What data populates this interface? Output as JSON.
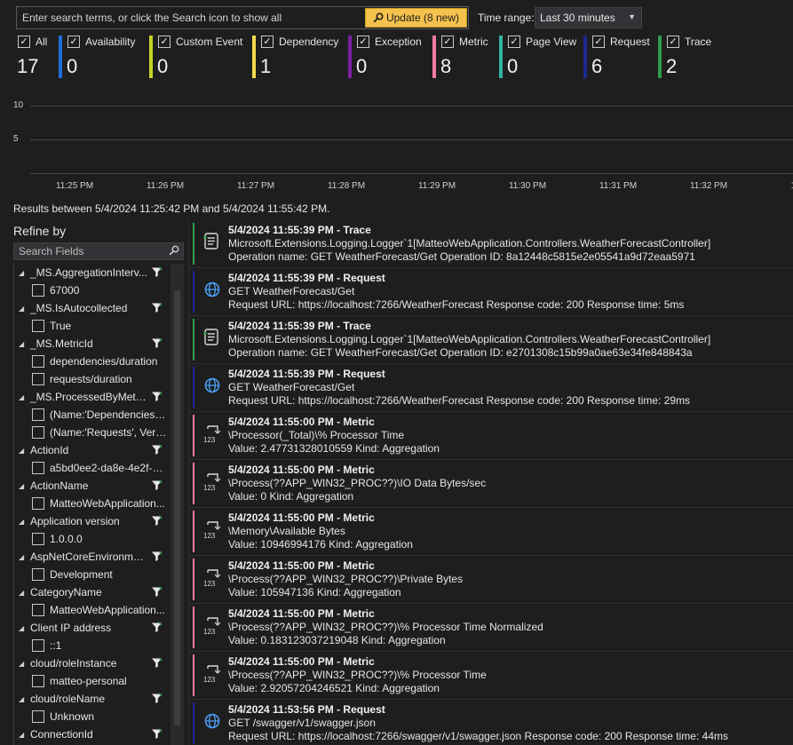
{
  "search": {
    "placeholder": "Enter search terms, or click the Search icon to show all",
    "update_label": "Update (8 new)"
  },
  "time_range": {
    "label": "Time range:",
    "selected": "Last 30 minutes"
  },
  "filters": [
    {
      "label": "All",
      "count": "17",
      "checked": true,
      "color": ""
    },
    {
      "label": "Availability",
      "count": "0",
      "checked": true,
      "color": "#1e6fd9"
    },
    {
      "label": "Custom Event",
      "count": "0",
      "checked": true,
      "color": "#c8d32a"
    },
    {
      "label": "Dependency",
      "count": "1",
      "checked": true,
      "color": "#f2d94e"
    },
    {
      "label": "Exception",
      "count": "0",
      "checked": true,
      "color": "#7a1fa2"
    },
    {
      "label": "Metric",
      "count": "8",
      "checked": true,
      "color": "#f27ca8"
    },
    {
      "label": "Page View",
      "count": "0",
      "checked": true,
      "color": "#2fb4a0"
    },
    {
      "label": "Request",
      "count": "6",
      "checked": true,
      "color": "#1b2a8f"
    },
    {
      "label": "Trace",
      "count": "2",
      "checked": true,
      "color": "#2e9e4f"
    }
  ],
  "chart_data": {
    "type": "bar",
    "y_ticks": [
      "10",
      "5"
    ],
    "ylim": [
      0,
      10
    ],
    "categories": [
      "11:25 PM",
      "11:26 PM",
      "11:27 PM",
      "11:28 PM",
      "11:29 PM",
      "11:30 PM",
      "11:31 PM",
      "11:32 PM",
      "11:3"
    ],
    "values": [],
    "grid": true
  },
  "results_range": "Results between 5/4/2024 11:25:42 PM and 5/4/2024 11:55:42 PM.",
  "refine": {
    "title": "Refine by",
    "search_placeholder": "Search Fields",
    "facets": [
      {
        "name": "_MS.AggregationInterv...",
        "values": [
          "67000"
        ]
      },
      {
        "name": "_MS.IsAutocollected",
        "values": [
          "True"
        ]
      },
      {
        "name": "_MS.MetricId",
        "values": [
          "dependencies/duration",
          "requests/duration"
        ]
      },
      {
        "name": "_MS.ProcessedByMetri...",
        "values": [
          "(Name:'Dependencies',...",
          "(Name:'Requests', Ver:'..."
        ]
      },
      {
        "name": "ActionId",
        "values": [
          "a5bd0ee2-da8e-4e2f-9..."
        ]
      },
      {
        "name": "ActionName",
        "values": [
          "MatteoWebApplication..."
        ]
      },
      {
        "name": "Application version",
        "values": [
          "1.0.0.0"
        ]
      },
      {
        "name": "AspNetCoreEnvironme...",
        "values": [
          "Development"
        ]
      },
      {
        "name": "CategoryName",
        "values": [
          "MatteoWebApplication..."
        ]
      },
      {
        "name": "Client IP address",
        "values": [
          "::1"
        ]
      },
      {
        "name": "cloud/roleInstance",
        "values": [
          "matteo-personal"
        ]
      },
      {
        "name": "cloud/roleName",
        "values": [
          "Unknown"
        ]
      },
      {
        "name": "ConnectionId",
        "values": []
      }
    ]
  },
  "results": [
    {
      "kind": "trace",
      "color": "#2e9e4f",
      "title": "5/4/2024 11:55:39 PM - Trace",
      "line2": "Microsoft.Extensions.Logging.Logger`1[MatteoWebApplication.Controllers.WeatherForecastController]",
      "line3": "Operation name: GET WeatherForecast/Get  Operation ID: 8a12448c5815e2e05541a9d72eaa5971"
    },
    {
      "kind": "request",
      "color": "#1b2a8f",
      "title": "5/4/2024 11:55:39 PM - Request",
      "line2": "GET WeatherForecast/Get",
      "line3": "Request URL: https://localhost:7266/WeatherForecast  Response code: 200  Response time: 5ms"
    },
    {
      "kind": "trace",
      "color": "#2e9e4f",
      "title": "5/4/2024 11:55:39 PM - Trace",
      "line2": "Microsoft.Extensions.Logging.Logger`1[MatteoWebApplication.Controllers.WeatherForecastController]",
      "line3": "Operation name: GET WeatherForecast/Get  Operation ID: e2701308c15b99a0ae63e34fe848843a"
    },
    {
      "kind": "request",
      "color": "#1b2a8f",
      "title": "5/4/2024 11:55:39 PM - Request",
      "line2": "GET WeatherForecast/Get",
      "line3": "Request URL: https://localhost:7266/WeatherForecast  Response code: 200  Response time: 29ms"
    },
    {
      "kind": "metric",
      "color": "#f27ca8",
      "title": "5/4/2024 11:55:00 PM - Metric",
      "line2": "\\Processor(_Total)\\% Processor Time",
      "line3": "Value: 2.47731328010559  Kind: Aggregation"
    },
    {
      "kind": "metric",
      "color": "#f27ca8",
      "title": "5/4/2024 11:55:00 PM - Metric",
      "line2": "\\Process(??APP_WIN32_PROC??)\\IO Data Bytes/sec",
      "line3": "Value: 0  Kind: Aggregation"
    },
    {
      "kind": "metric",
      "color": "#f27ca8",
      "title": "5/4/2024 11:55:00 PM - Metric",
      "line2": "\\Memory\\Available Bytes",
      "line3": "Value: 10946994176  Kind: Aggregation"
    },
    {
      "kind": "metric",
      "color": "#f27ca8",
      "title": "5/4/2024 11:55:00 PM - Metric",
      "line2": "\\Process(??APP_WIN32_PROC??)\\Private Bytes",
      "line3": "Value: 105947136  Kind: Aggregation"
    },
    {
      "kind": "metric",
      "color": "#f27ca8",
      "title": "5/4/2024 11:55:00 PM - Metric",
      "line2": "\\Process(??APP_WIN32_PROC??)\\% Processor Time Normalized",
      "line3": "Value: 0.183123037219048  Kind: Aggregation"
    },
    {
      "kind": "metric",
      "color": "#f27ca8",
      "title": "5/4/2024 11:55:00 PM - Metric",
      "line2": "\\Process(??APP_WIN32_PROC??)\\% Processor Time",
      "line3": "Value: 2.92057204246521  Kind: Aggregation"
    },
    {
      "kind": "request",
      "color": "#1b2a8f",
      "title": "5/4/2024 11:53:56 PM - Request",
      "line2": "GET /swagger/v1/swagger.json",
      "line3": "Request URL: https://localhost:7266/swagger/v1/swagger.json  Response code: 200  Response time: 44ms"
    }
  ]
}
